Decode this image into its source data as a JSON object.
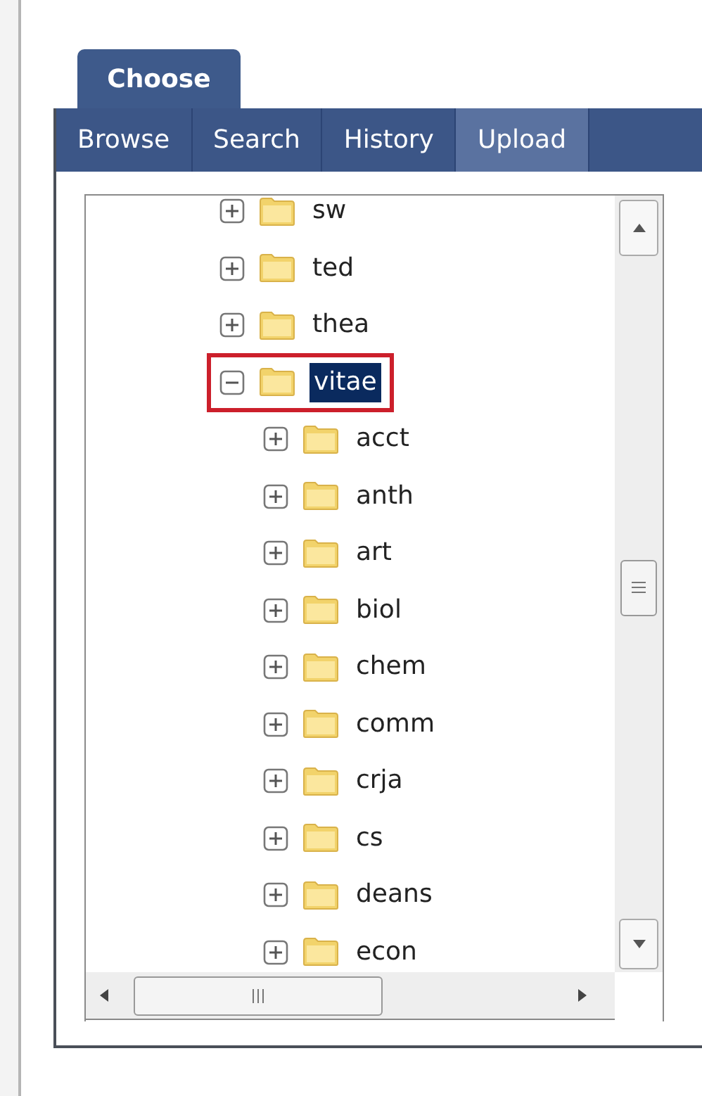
{
  "tab": {
    "label": "Choose",
    "selected": true
  },
  "nav": [
    {
      "label": "Browse",
      "selected": false
    },
    {
      "label": "Search",
      "selected": false
    },
    {
      "label": "History",
      "selected": false
    },
    {
      "label": "Upload",
      "selected": true
    }
  ],
  "tree": [
    {
      "label": "sw",
      "expanded": false,
      "selected": false,
      "highlighted": false
    },
    {
      "label": "ted",
      "expanded": false,
      "selected": false,
      "highlighted": false
    },
    {
      "label": "thea",
      "expanded": false,
      "selected": false,
      "highlighted": false
    },
    {
      "label": "vitae",
      "expanded": true,
      "selected": true,
      "highlighted": true,
      "children": [
        {
          "label": "acct",
          "expanded": false,
          "selected": false,
          "highlighted": false
        },
        {
          "label": "anth",
          "expanded": false,
          "selected": false,
          "highlighted": false
        },
        {
          "label": "art",
          "expanded": false,
          "selected": false,
          "highlighted": false
        },
        {
          "label": "biol",
          "expanded": false,
          "selected": false,
          "highlighted": false
        },
        {
          "label": "chem",
          "expanded": false,
          "selected": false,
          "highlighted": false
        },
        {
          "label": "comm",
          "expanded": false,
          "selected": false,
          "highlighted": false
        },
        {
          "label": "crja",
          "expanded": false,
          "selected": false,
          "highlighted": false
        },
        {
          "label": "cs",
          "expanded": false,
          "selected": false,
          "highlighted": false
        },
        {
          "label": "deans",
          "expanded": false,
          "selected": false,
          "highlighted": false
        },
        {
          "label": "econ",
          "expanded": false,
          "selected": false,
          "highlighted": false
        }
      ]
    }
  ]
}
